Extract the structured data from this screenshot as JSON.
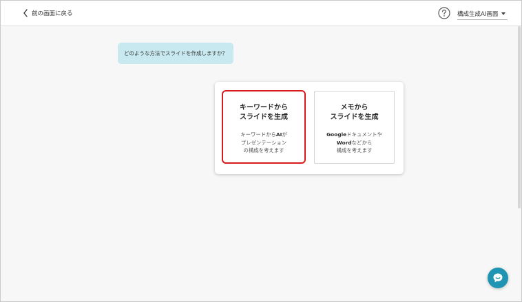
{
  "header": {
    "back_label": "前の画面に戻る",
    "help_icon": "question-circle-icon",
    "mode_select_label": "構成生成AI画面"
  },
  "prompt": {
    "question": "どのような方法でスライドを作成しますか？"
  },
  "options": {
    "keyword": {
      "title_line1": "キーワードから",
      "title_line2": "スライドを生成",
      "desc_line1_a": "キーワードから",
      "desc_line1_b": "AI",
      "desc_line1_c": "が",
      "desc_line2": "プレゼンテーション",
      "desc_line3": "の構成を考えます"
    },
    "memo": {
      "title_line1": "メモから",
      "title_line2": "スライドを生成",
      "desc_line1_a": "Google",
      "desc_line1_b": "ドキュメントや",
      "desc_line2_a": "Word",
      "desc_line2_b": "などから",
      "desc_line3": "構成を考えます"
    }
  },
  "chat": {
    "icon": "chat-bubble-icon"
  },
  "colors": {
    "bubble_bg": "#c8e9ef",
    "selected_border": "#d7191c",
    "chat_button": "#1f94b3"
  }
}
